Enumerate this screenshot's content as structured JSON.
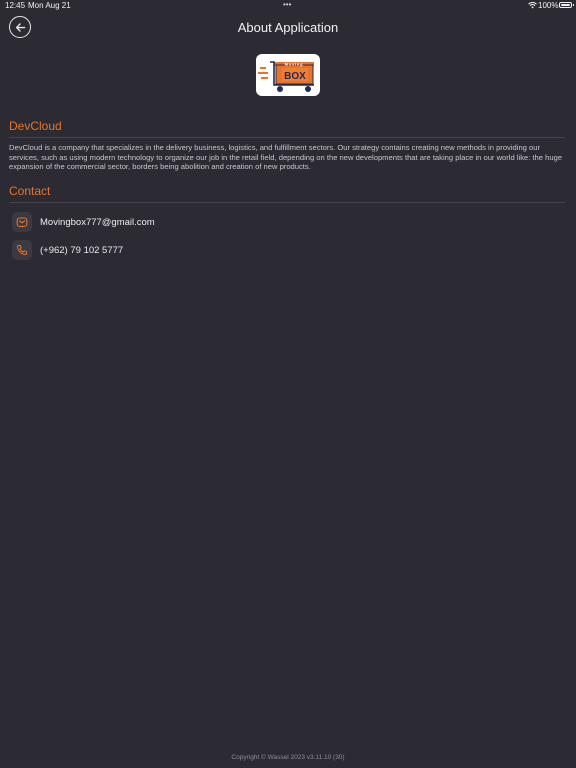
{
  "status_bar": {
    "time": "12:45",
    "date": "Mon Aug 21",
    "dots": "•••",
    "battery": "100%"
  },
  "header": {
    "title": "About Application",
    "back_icon": "arrow-left-icon"
  },
  "logo": {
    "top_text": "Moving",
    "box_text": "BOX",
    "colors": {
      "orange": "#e8732a",
      "navy": "#1f2a57"
    }
  },
  "about": {
    "title": "DevCloud",
    "body": "DevCloud is a company that specializes in the delivery business, logistics, and fulfillment sectors. Our strategy contains creating new methods in providing our services, such as using modern technology to organize our job in the retail field, depending on the new developments that are taking place in our world like: the huge expansion of the commercial sector, borders being abolition and creation of new products."
  },
  "contact": {
    "title": "Contact",
    "items": [
      {
        "icon": "email-icon",
        "value": "Movingbox777@gmail.com"
      },
      {
        "icon": "phone-icon",
        "value": "(+962) 79 102 5777"
      }
    ]
  },
  "footer": {
    "copyright": "Copyright © Wassel 2023 v3.11.10 (30)"
  },
  "colors": {
    "background": "#2c2b34",
    "accent": "#e8732a",
    "divider": "#45444d"
  }
}
